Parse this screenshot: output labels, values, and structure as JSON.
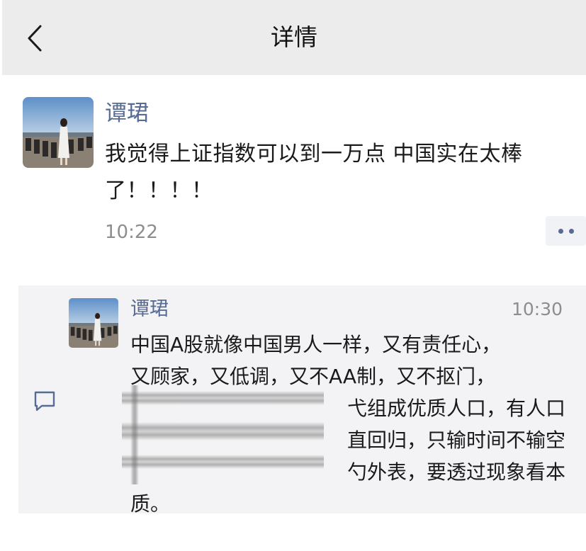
{
  "header": {
    "title": "详情",
    "back_icon": "chevron-left-icon"
  },
  "post": {
    "author": "谭珺",
    "text": "我觉得上证指数可以到一万点 中国实在太棒了！！！！",
    "time": "10:22",
    "more_icon": "more-dots-icon"
  },
  "comment": {
    "icon": "comment-bubble-icon",
    "author": "谭珺",
    "time": "10:30",
    "lines": [
      "中国A股就像中国男人一样，又有责任心，",
      "又顾家，又低调，又不AA制，又不抠门，",
      "弋组成优质人口，有人口",
      "直回归，只输时间不输空",
      "勺外表，要透过现象看本",
      "质。"
    ]
  },
  "colors": {
    "name_blue": "#576b95",
    "header_bg": "#ececec",
    "comment_bg": "#f3f3f5",
    "time_gray": "#8d8d8d"
  }
}
